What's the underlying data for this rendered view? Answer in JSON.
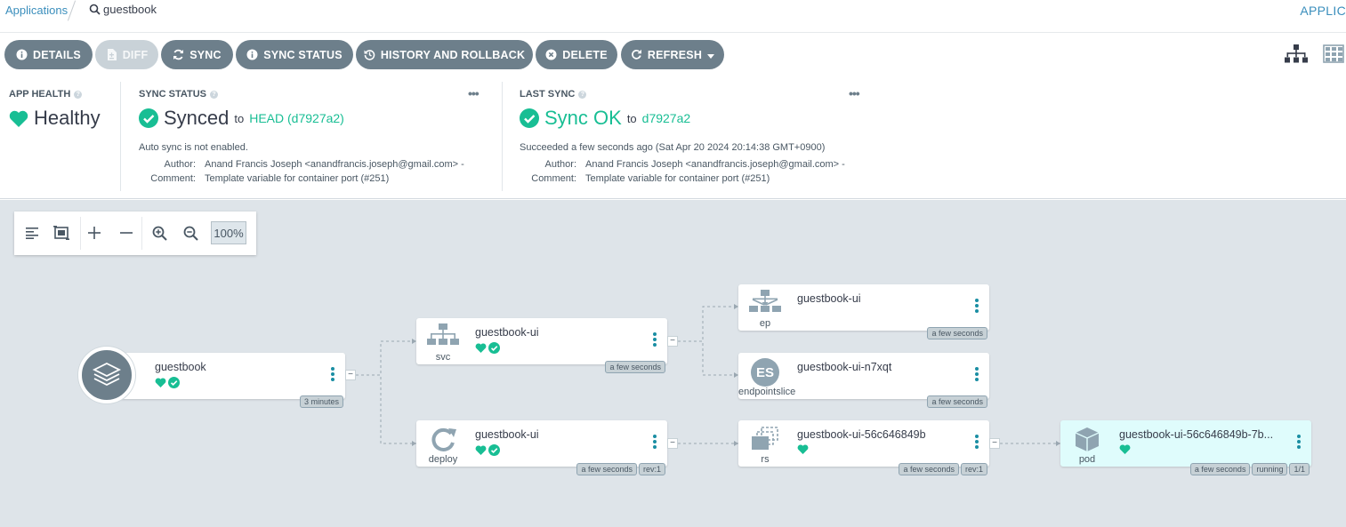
{
  "breadcrumb": {
    "root": "Applications",
    "current": "guestbook"
  },
  "top_right": "APPLIC",
  "toolbar": {
    "details": "DETAILS",
    "diff": "DIFF",
    "sync": "SYNC",
    "sync_status": "SYNC STATUS",
    "history": "HISTORY AND ROLLBACK",
    "delete": "DELETE",
    "refresh": "REFRESH"
  },
  "app_health": {
    "title": "APP HEALTH",
    "value": "Healthy"
  },
  "sync_status": {
    "title": "SYNC STATUS",
    "value": "Synced",
    "to": "to",
    "revision": "HEAD (d7927a2)",
    "note": "Auto sync is not enabled.",
    "author_label": "Author:",
    "author": "Anand Francis Joseph <anandfrancis.joseph@gmail.com> -",
    "comment_label": "Comment:",
    "comment": "Template variable for container port (#251)"
  },
  "last_sync": {
    "title": "LAST SYNC",
    "value": "Sync OK",
    "to": "to",
    "revision": "d7927a2",
    "note": "Succeeded a few seconds ago (Sat Apr 20 2024 20:14:38 GMT+0900)",
    "author_label": "Author:",
    "author": "Anand Francis Joseph <anandfrancis.joseph@gmail.com> -",
    "comment_label": "Comment:",
    "comment": "Template variable for container port (#251)"
  },
  "zoom": "100%",
  "nodes": {
    "app": {
      "name": "guestbook",
      "age": "3 minutes"
    },
    "svc": {
      "name": "guestbook-ui",
      "kind": "svc",
      "age": "a few seconds"
    },
    "deploy": {
      "name": "guestbook-ui",
      "kind": "deploy",
      "age": "a few seconds",
      "rev": "rev:1"
    },
    "ep": {
      "name": "guestbook-ui",
      "kind": "ep",
      "age": "a few seconds"
    },
    "endpointslice": {
      "name": "guestbook-ui-n7xqt",
      "kind": "endpointslice",
      "badge": "ES",
      "age": "a few seconds"
    },
    "rs": {
      "name": "guestbook-ui-56c646849b",
      "kind": "rs",
      "age": "a few seconds",
      "rev": "rev:1"
    },
    "pod": {
      "name": "guestbook-ui-56c646849b-7b...",
      "kind": "pod",
      "age": "a few seconds",
      "state": "running",
      "ready": "1/1"
    }
  },
  "colors": {
    "healthy": "#18be94",
    "button": "#6d7f8b",
    "graph_bg": "#dee4e9",
    "link": "#3a8ebc"
  }
}
